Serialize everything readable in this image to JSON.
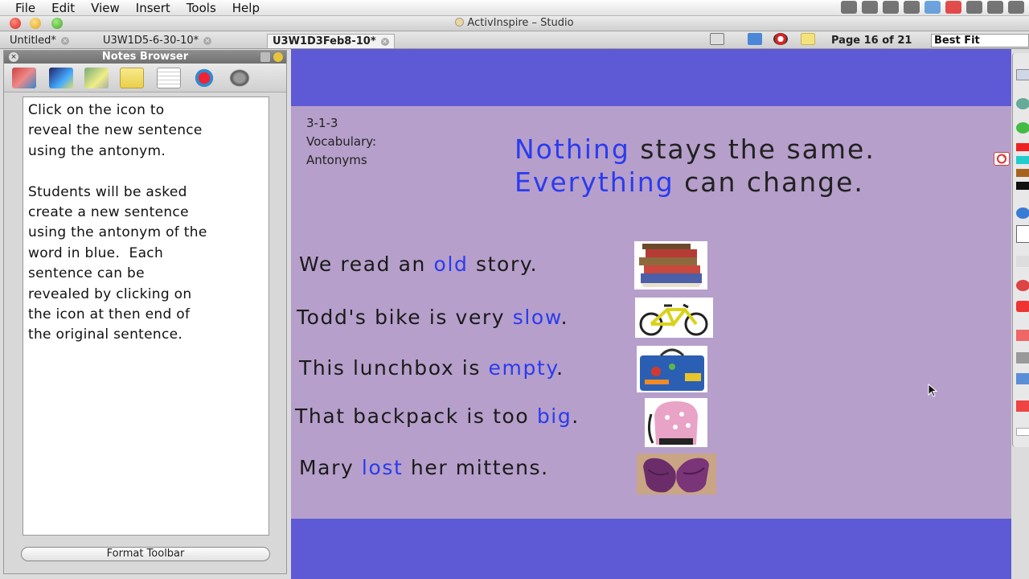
{
  "menubar": {
    "items": [
      "File",
      "Edit",
      "View",
      "Insert",
      "Tools",
      "Help"
    ]
  },
  "window": {
    "title": "ActivInspire – Studio"
  },
  "tabs": [
    {
      "label": "Untitled*"
    },
    {
      "label": "U3W1D5-6-30-10*"
    },
    {
      "label": "U3W1D3Feb8-10*"
    }
  ],
  "page_indicator": "Page 16 of 21",
  "zoom": "Best Fit",
  "notes_browser": {
    "title": "Notes Browser",
    "note_text": "Click on the icon to\nreveal the new sentence\nusing the antonym.\n\nStudents will be asked\ncreate a new sentence\nusing the antonym of the\nword in blue.  Each\nsentence can be\nrevealed by clicking on\nthe icon at then end of\nthe original sentence.",
    "format_toolbar_label": "Format Toolbar"
  },
  "flipchart": {
    "meta_lines": [
      "3-1-3",
      "Vocabulary:",
      "Antonyms"
    ],
    "headline": [
      {
        "highlight": "Nothing",
        "rest": " stays the same."
      },
      {
        "highlight": "Everything",
        "rest": " can change."
      }
    ],
    "sentences": [
      {
        "before": "We read an ",
        "word": "old",
        "after": " story.",
        "image": "books"
      },
      {
        "before": "Todd's bike is very ",
        "word": "slow",
        "after": ".",
        "image": "bicycle"
      },
      {
        "before": "This lunchbox is ",
        "word": "empty",
        "after": ".",
        "image": "lunchbox"
      },
      {
        "before": "That backpack is too ",
        "word": "big",
        "after": ".",
        "image": "backpack"
      },
      {
        "before": "Mary ",
        "word": "lost",
        "after": " her mittens.",
        "image": "mittens"
      }
    ]
  },
  "colors": {
    "canvas_band": "#5e5ad5",
    "page_background": "#b69fca",
    "highlight_word": "#2a3bf0"
  }
}
